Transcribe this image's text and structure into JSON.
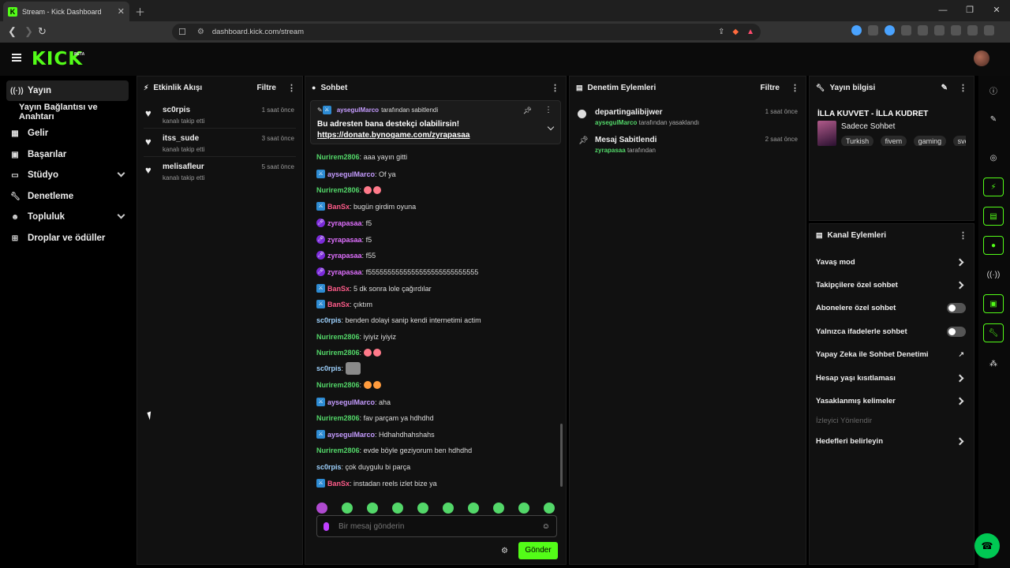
{
  "browser": {
    "tab_title": "Stream - Kick Dashboard",
    "url": "dashboard.kick.com/stream"
  },
  "app": {
    "logo": "KICK",
    "beta": "BETA"
  },
  "sidebar": {
    "items": [
      {
        "label": "Yayın",
        "icon": "broadcast-icon"
      },
      {
        "label": "Yayın Bağlantısı ve Anahtarı",
        "icon": ""
      },
      {
        "label": "Gelir",
        "icon": "money-icon"
      },
      {
        "label": "Başarılar",
        "icon": "trophy-icon"
      },
      {
        "label": "Stüdyo",
        "icon": "studio-icon"
      },
      {
        "label": "Denetleme",
        "icon": "wrench-icon"
      },
      {
        "label": "Topluluk",
        "icon": "people-icon"
      },
      {
        "label": "Droplar ve ödüller",
        "icon": "gift-icon"
      }
    ]
  },
  "activity": {
    "title": "Etkinlik Akışı",
    "filter": "Filtre",
    "events": [
      {
        "user": "sc0rpis",
        "action": "kanalı takip etti",
        "time": "1 saat önce"
      },
      {
        "user": "itss_sude",
        "action": "kanalı takip etti",
        "time": "3 saat önce"
      },
      {
        "user": "melisafleur",
        "action": "kanalı takip etti",
        "time": "5 saat önce"
      }
    ]
  },
  "chat": {
    "title": "Sohbet",
    "pinned": {
      "by_user": "aysegulMarco",
      "by_suffix": "tarafından sabitlendi",
      "message": "Bu adresten bana destekçi olabilirsin!",
      "link": "https://donate.bynogame.com/zyrapasaa"
    },
    "messages": [
      {
        "user": "Nurirem2806",
        "text": "aaa yayın gitti"
      },
      {
        "user": "aysegulMarco",
        "text": "Of ya"
      },
      {
        "user": "Nurirem2806",
        "text": ""
      },
      {
        "user": "BanSx",
        "text": "bugün girdim oyuna"
      },
      {
        "user": "zyrapasaa",
        "text": "f5"
      },
      {
        "user": "zyrapasaa",
        "text": "f5"
      },
      {
        "user": "zyrapasaa",
        "text": "f55"
      },
      {
        "user": "zyrapasaa",
        "text": "f5555555555555555555555555555"
      },
      {
        "user": "BanSx",
        "text": "5 dk sonra lole çağırdılar"
      },
      {
        "user": "BanSx",
        "text": "çıktım"
      },
      {
        "user": "sc0rpis",
        "text": "benden dolayi sanip kendi internetimi actim"
      },
      {
        "user": "Nurirem2806",
        "text": "iyiyiz iyiyiz"
      },
      {
        "user": "Nurirem2806",
        "text": ""
      },
      {
        "user": "sc0rpis",
        "text": ""
      },
      {
        "user": "Nurirem2806",
        "text": ""
      },
      {
        "user": "aysegulMarco",
        "text": "aha"
      },
      {
        "user": "Nurirem2806",
        "text": "fav parçam ya hdhdhd"
      },
      {
        "user": "aysegulMarco",
        "text": "Hdhahdhahshahs"
      },
      {
        "user": "Nurirem2806",
        "text": "evde böyle geziyorum ben hdhdhd"
      },
      {
        "user": "sc0rpis",
        "text": "çok duygulu bi parça"
      },
      {
        "user": "BanSx",
        "text": "instadan reels izlet bize ya"
      }
    ],
    "input_placeholder": "Bir mesaj gönderin",
    "send": "Gönder"
  },
  "moderation": {
    "title": "Denetim Eylemleri",
    "filter": "Filtre",
    "items": [
      {
        "title": "departingalibijwer",
        "user": "aysegulMarco",
        "suffix": "tarafından yasaklandı",
        "time": "1 saat önce"
      },
      {
        "title": "Mesaj Sabitlendi",
        "user": "zyrapasaa",
        "suffix": "tarafından",
        "time": "2 saat önce"
      }
    ]
  },
  "stream_info": {
    "title": "Yayın bilgisi",
    "stream_title": "İLLA KUVVET - İLLA KUDRET",
    "category": "Sadece Sohbet",
    "tags": [
      "Turkish",
      "fivem",
      "gaming",
      "svel"
    ]
  },
  "channel_actions": {
    "title": "Kanal Eylemleri",
    "items": [
      {
        "label": "Yavaş mod",
        "kind": "chevron"
      },
      {
        "label": "Takipçilere özel sohbet",
        "kind": "chevron"
      },
      {
        "label": "Abonelere özel sohbet",
        "kind": "toggle",
        "on": false
      },
      {
        "label": "Yalnızca ifadelerle sohbet",
        "kind": "toggle",
        "on": false
      },
      {
        "label": "Yapay Zeka ile Sohbet Denetimi",
        "kind": "external"
      },
      {
        "label": "Hesap yaşı kısıtlaması",
        "kind": "chevron"
      },
      {
        "label": "Yasaklanmış kelimeler",
        "kind": "chevron"
      },
      {
        "label": "İzleyici Yönlendir",
        "kind": "disabled"
      },
      {
        "label": "Hedefleri belirleyin",
        "kind": "chevron"
      }
    ]
  },
  "colors": {
    "brand": "#53fc18",
    "panel": "#111111",
    "background": "#000000"
  }
}
